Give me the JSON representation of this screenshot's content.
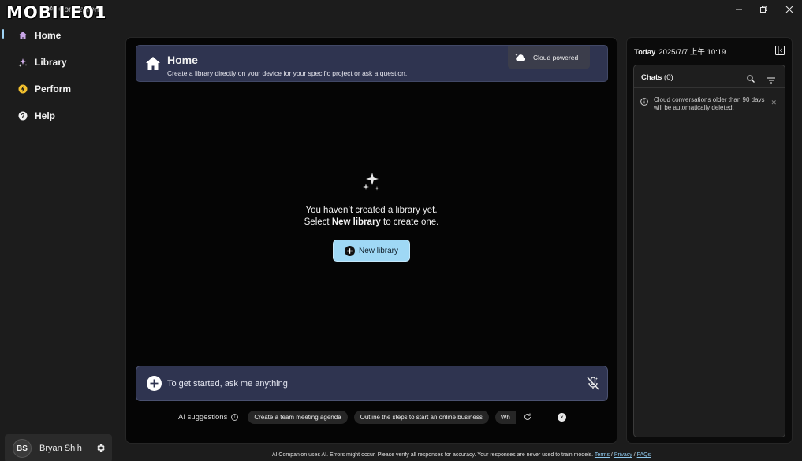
{
  "window": {
    "watermark": "MOBILE01",
    "app_title": "AI Companion",
    "controls": [
      "minimize-icon",
      "restore-icon",
      "close-icon"
    ]
  },
  "nav": {
    "items": [
      {
        "label": "Home",
        "icon": "home-icon",
        "active": true
      },
      {
        "label": "Library",
        "icon": "library-icon"
      },
      {
        "label": "Perform",
        "icon": "perform-icon"
      },
      {
        "label": "Help",
        "icon": "help-icon"
      }
    ],
    "user": {
      "initials": "BS",
      "name": "Bryan Shih"
    }
  },
  "main": {
    "banner": {
      "title": "Home",
      "subtitle": "Create a library directly on your device for your specific project or ask a question.",
      "cloud_label": "Cloud powered"
    },
    "empty": {
      "line1": "You haven’t created a library yet.",
      "line2_pre": "Select ",
      "line2_bold": "New library",
      "line2_post": " to create one.",
      "button": "New library"
    },
    "input": {
      "placeholder": "To get started, ask me anything"
    },
    "suggestions": {
      "label": "AI suggestions",
      "chips": [
        "Create a team meeting agenda",
        "Outline the steps to start an online business",
        "Wh"
      ]
    }
  },
  "right": {
    "today_label": "Today",
    "datetime": "2025/7/7 上午 10:19",
    "chats_label": "Chats",
    "chats_count": "(0)",
    "notice": "Cloud conversations older than 90 days will be automatically deleted."
  },
  "footer": {
    "text": "AI Companion uses AI. Errors might occur. Please verify all responses for accuracy. Your responses are never used to train models. ",
    "links": [
      "Terms",
      "Privacy",
      "FAQs"
    ],
    "separator": " / "
  },
  "colors": {
    "accent": "#9fd8f5",
    "banner": "#2f3450",
    "background": "#1c1c1c"
  }
}
